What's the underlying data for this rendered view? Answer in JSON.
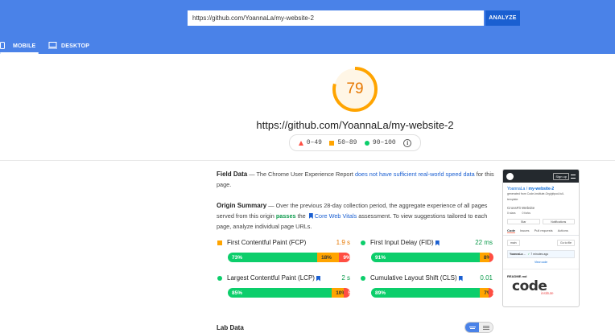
{
  "header": {
    "url_value": "https://github.com/YoannaLa/my-website-2",
    "analyze_label": "ANALYZE",
    "tabs": [
      {
        "label": "MOBILE",
        "icon": "phone-icon",
        "active": true
      },
      {
        "label": "DESKTOP",
        "icon": "desktop-icon",
        "active": false
      }
    ]
  },
  "score": {
    "value": "79",
    "fraction": 0.79,
    "color": "#ffa400",
    "url": "https://github.com/YoannaLa/my-website-2"
  },
  "legend": {
    "fail": "0–49",
    "average": "50–89",
    "pass": "90–100"
  },
  "field_data": {
    "title": "Field Data",
    "text_1": " — The Chrome User Experience Report ",
    "link": "does not have sufficient real-world speed data",
    "text_2": " for this page."
  },
  "origin_summary": {
    "title": "Origin Summary",
    "text_1": " — Over the previous 28-day collection period, the aggregate experience of all pages served from this origin ",
    "passes": "passes",
    "text_2": " the ",
    "cwv": "Core Web Vitals",
    "text_3": " assessment. To view suggestions tailored to each page, analyze individual page URLs."
  },
  "metrics": [
    {
      "name": "First Contentful Paint (FCP)",
      "value": "1.9 s",
      "status": "average",
      "value_color": "#e67700",
      "core": false,
      "dist": [
        {
          "label": "73%",
          "pct": 73,
          "kind": "g"
        },
        {
          "label": "18%",
          "pct": 18,
          "kind": "o"
        },
        {
          "label": "9%",
          "pct": 9,
          "kind": "r"
        }
      ]
    },
    {
      "name": "First Input Delay (FID)",
      "value": "22 ms",
      "status": "pass",
      "value_color": "#0c9a4b",
      "core": true,
      "dist": [
        {
          "label": "91%",
          "pct": 91,
          "kind": "g"
        },
        {
          "label": "8%",
          "pct": 8,
          "kind": "o"
        },
        {
          "label": "1%",
          "pct": 1,
          "kind": "r"
        }
      ]
    },
    {
      "name": "Largest Contentful Paint (LCP)",
      "value": "2 s",
      "status": "pass",
      "value_color": "#0c9a4b",
      "core": true,
      "dist": [
        {
          "label": "85%",
          "pct": 85,
          "kind": "g"
        },
        {
          "label": "10%",
          "pct": 10,
          "kind": "o"
        },
        {
          "label": "5%",
          "pct": 5,
          "kind": "r"
        }
      ]
    },
    {
      "name": "Cumulative Layout Shift (CLS)",
      "value": "0.01",
      "status": "pass",
      "value_color": "#0c9a4b",
      "core": true,
      "dist": [
        {
          "label": "89%",
          "pct": 89,
          "kind": "g"
        },
        {
          "label": "7%",
          "pct": 7,
          "kind": "o"
        },
        {
          "label": "4%",
          "pct": 4,
          "kind": "r"
        }
      ]
    }
  ],
  "thumbnail": {
    "signup": "Sign up",
    "repo_owner": "YoannaLa",
    "repo_name": "my-website-2",
    "generated": "generated from Code-Institute-Org/gitpod-full-template",
    "description": "CrossFit Website",
    "stars": "0 stars",
    "forks": "0 forks",
    "star_btn": "Star",
    "notif_btn": "Notifications",
    "tabs": [
      "Code",
      "Issues",
      "Pull requests",
      "Actions"
    ],
    "branch": "main",
    "goto": "Go to file",
    "commit_user": "YoannaLa",
    "commit_msg": "...",
    "commit_time": "7 minutes ago",
    "view_code": "View code",
    "readme": "README.md",
    "logo_word": "code",
    "logo_sub": "institute"
  },
  "lab_data": {
    "title": "Lab Data"
  }
}
